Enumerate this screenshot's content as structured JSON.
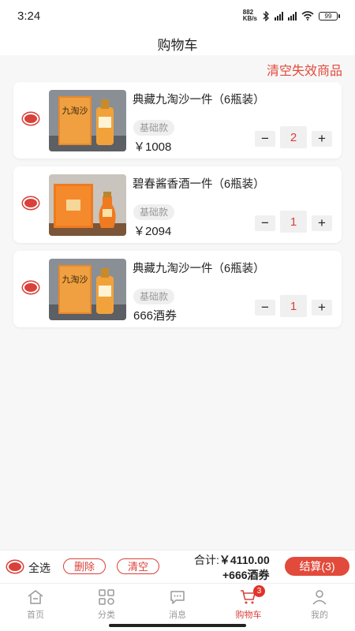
{
  "status": {
    "time": "3:24",
    "speed_top": "882",
    "speed_unit": "KB/s",
    "battery": "99"
  },
  "header": {
    "title": "购物车"
  },
  "actions": {
    "clear_invalid": "清空失效商品"
  },
  "items": [
    {
      "name": "典藏九淘沙一件（6瓶装）",
      "tag": "基础款",
      "price": "￥1008",
      "qty": "2",
      "selected": true,
      "minus": "−",
      "plus": "+"
    },
    {
      "name": "碧春酱香酒一件（6瓶装）",
      "tag": "基础款",
      "price": "￥2094",
      "qty": "1",
      "selected": true,
      "minus": "−",
      "plus": "+"
    },
    {
      "name": "典藏九淘沙一件（6瓶装）",
      "tag": "基础款",
      "price": "666酒券",
      "qty": "1",
      "selected": true,
      "minus": "−",
      "plus": "+"
    }
  ],
  "footer": {
    "select_all": "全选",
    "delete": "删除",
    "clear": "清空",
    "total_label": "合计:",
    "total_amount": "￥4110.00",
    "total_coupon": "+666酒券",
    "checkout": "结算(3)"
  },
  "tabs": [
    {
      "label": "首页",
      "icon": "home-icon"
    },
    {
      "label": "分类",
      "icon": "category-icon"
    },
    {
      "label": "消息",
      "icon": "message-icon"
    },
    {
      "label": "购物车",
      "icon": "cart-icon",
      "badge": "3",
      "active": true
    },
    {
      "label": "我的",
      "icon": "profile-icon"
    }
  ],
  "colors": {
    "accent": "#e24a3b",
    "text": "#222222",
    "muted": "#999999"
  }
}
